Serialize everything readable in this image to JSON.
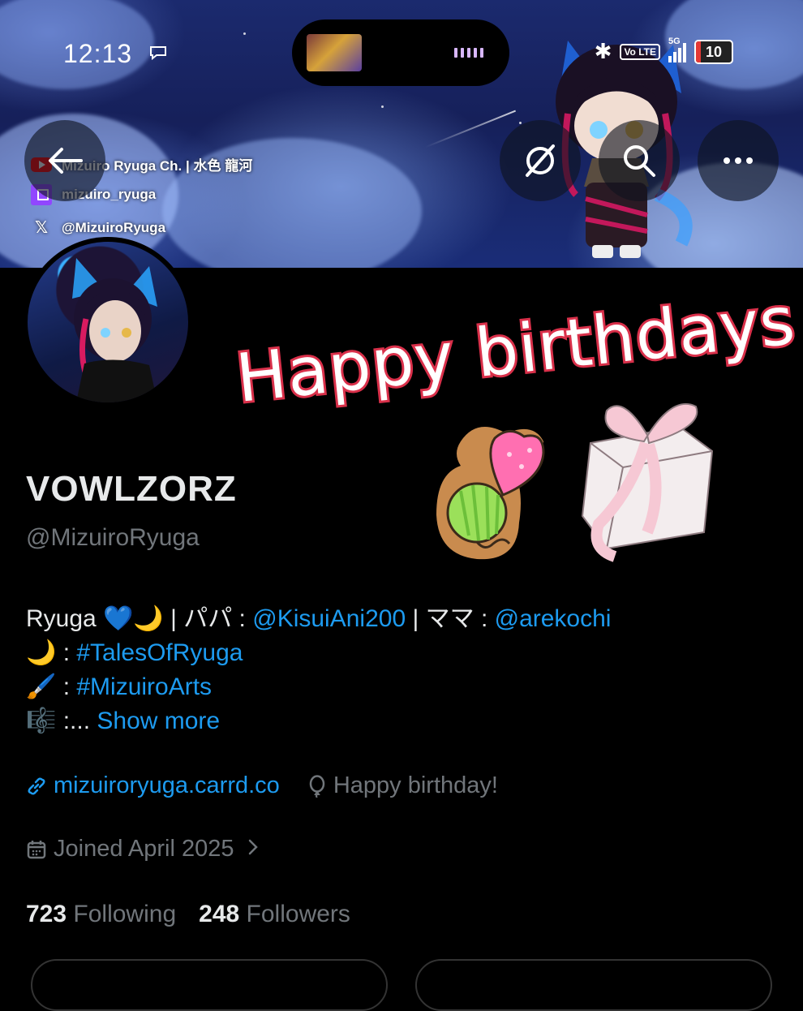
{
  "status_bar": {
    "time": "12:13",
    "network": "5G",
    "volte": "Vo LTE",
    "battery": "10"
  },
  "banner": {
    "socials": [
      {
        "platform": "youtube",
        "text": "Mizuiro Ryuga Ch. | 水色 龍河"
      },
      {
        "platform": "twitch",
        "text": "mizuiro_ryuga"
      },
      {
        "platform": "x",
        "text": "@MizuiroRyuga"
      }
    ]
  },
  "profile": {
    "display_name": "VOWLZORZ",
    "handle": "@MizuiroRyuga",
    "sticker_text": "Happy birthdays",
    "bio": {
      "line1_prefix": "Ryuga 💙🌙 | パパ : ",
      "line1_papa": "@KisuiAni200",
      "line1_mid": " | ママ : ",
      "line1_mama": "@arekochi",
      "line2_prefix": "🌙 : ",
      "line2_tag": "#TalesOfRyuga",
      "line3_prefix": "🖌️ : ",
      "line3_tag": "#MizuiroArts",
      "line4_prefix": "🎼 :... ",
      "show_more": "Show more"
    },
    "website": "mizuiroryuga.carrd.co",
    "birthday": "Happy birthday!",
    "joined": "Joined April 2025",
    "following_count": "723",
    "following_label": "Following",
    "followers_count": "248",
    "followers_label": "Followers"
  },
  "colors": {
    "accent": "#1d9bf0",
    "muted": "#71767b",
    "text": "#e7e9ea",
    "background": "#000000",
    "sticker_outline": "#d9304a"
  },
  "icons": {
    "back": "arrow-left-icon",
    "grok": "grok-slash-icon",
    "search": "search-icon",
    "more": "more-horizontal-icon",
    "link": "link-icon",
    "balloon": "balloon-icon",
    "calendar": "calendar-icon",
    "chevron": "chevron-right-icon"
  }
}
